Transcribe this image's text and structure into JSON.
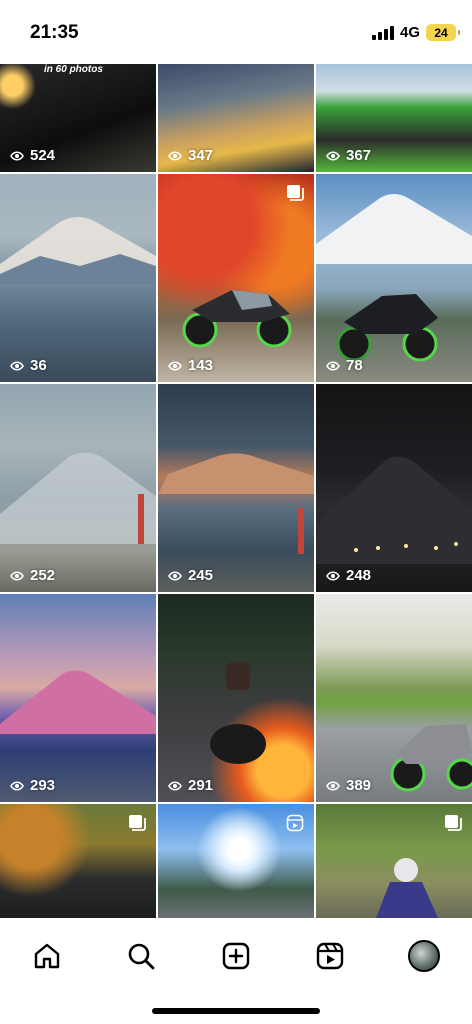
{
  "status_bar": {
    "time": "21:35",
    "network": "4G",
    "battery": "24"
  },
  "grid": {
    "caption": "in 60 photos",
    "tiles": [
      {
        "views": "524",
        "icon": "none"
      },
      {
        "views": "347",
        "icon": "none"
      },
      {
        "views": "367",
        "icon": "none"
      },
      {
        "views": "36",
        "icon": "none"
      },
      {
        "views": "143",
        "icon": "carousel-icon"
      },
      {
        "views": "78",
        "icon": "none"
      },
      {
        "views": "252",
        "icon": "none"
      },
      {
        "views": "245",
        "icon": "none"
      },
      {
        "views": "248",
        "icon": "none"
      },
      {
        "views": "293",
        "icon": "none"
      },
      {
        "views": "291",
        "icon": "none"
      },
      {
        "views": "389",
        "icon": "none"
      },
      {
        "views": "",
        "icon": "carousel-icon"
      },
      {
        "views": "",
        "icon": "reel-icon"
      },
      {
        "views": "",
        "icon": "carousel-icon"
      }
    ]
  },
  "tab_bar": {
    "items": [
      "home-icon",
      "search-icon",
      "create-icon",
      "reels-icon",
      "profile-avatar"
    ]
  }
}
